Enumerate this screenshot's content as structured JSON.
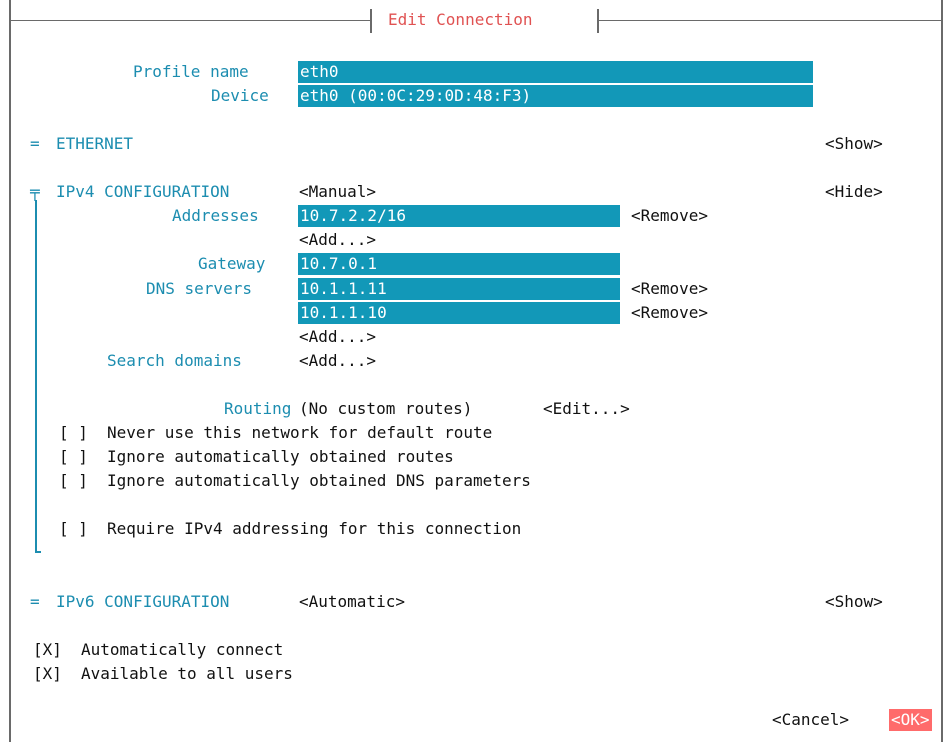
{
  "dialog": {
    "title": "Edit Connection"
  },
  "profile": {
    "profile_name_label": "Profile name",
    "profile_name_value": "eth0",
    "device_label": "Device",
    "device_value": "eth0 (00:0C:29:0D:48:F3)"
  },
  "ethernet": {
    "marker": "=",
    "heading": "ETHERNET",
    "toggle": "<Show>"
  },
  "ipv4": {
    "marker": "╤",
    "heading": "IPv4 CONFIGURATION",
    "mode": "<Manual>",
    "toggle": "<Hide>",
    "addresses_label": "Addresses",
    "addresses": [
      {
        "value": "10.7.2.2/16",
        "remove": "<Remove>"
      }
    ],
    "add_address": "<Add...>",
    "gateway_label": "Gateway",
    "gateway_value": "10.7.0.1",
    "dns_label": "DNS servers",
    "dns_servers": [
      {
        "value": "10.1.1.11",
        "remove": "<Remove>"
      },
      {
        "value": "10.1.1.10",
        "remove": "<Remove>"
      }
    ],
    "add_dns": "<Add...>",
    "search_domains_label": "Search domains",
    "add_search_domain": "<Add...>",
    "routing_label": "Routing",
    "routing_value": "(No custom routes)",
    "routing_edit": "<Edit...>",
    "checkboxes": [
      {
        "box": "[ ]",
        "label": "Never use this network for default route"
      },
      {
        "box": "[ ]",
        "label": "Ignore automatically obtained routes"
      },
      {
        "box": "[ ]",
        "label": "Ignore automatically obtained DNS parameters"
      },
      {
        "box": "[ ]",
        "label": "Require IPv4 addressing for this connection"
      }
    ]
  },
  "ipv6": {
    "marker": "=",
    "heading": "IPv6 CONFIGURATION",
    "mode": "<Automatic>",
    "toggle": "<Show>"
  },
  "general": {
    "checkboxes": [
      {
        "box": "[X]",
        "label": "Automatically connect"
      },
      {
        "box": "[X]",
        "label": "Available to all users"
      }
    ]
  },
  "footer": {
    "cancel": "<Cancel>",
    "ok": "<OK>"
  },
  "colors": {
    "accent": "#1298b8",
    "title": "#e05252",
    "ok_bg": "#ff6b6b",
    "frame": "#6a6a6a"
  }
}
